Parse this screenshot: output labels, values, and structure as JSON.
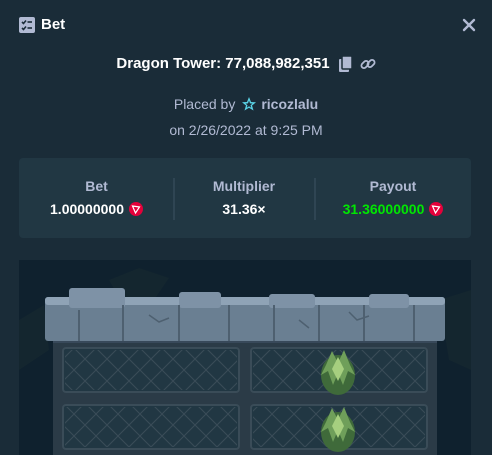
{
  "header": {
    "title": "Bet",
    "icon": "bet-slip-icon",
    "close_icon": "close-icon"
  },
  "game": {
    "title": "Dragon Tower: 77,088,982,351",
    "copy_icon": "copy-icon",
    "link_icon": "link-icon"
  },
  "placed": {
    "prefix": "Placed by",
    "username": "ricozlalu",
    "user_icon": "vip-star-icon",
    "date": "on 2/26/2022 at 9:25 PM"
  },
  "stats": {
    "bet": {
      "label": "Bet",
      "value": "1.00000000",
      "currency_icon": "tron-coin-icon"
    },
    "multiplier": {
      "label": "Multiplier",
      "value": "31.36×"
    },
    "payout": {
      "label": "Payout",
      "value": "31.36000000",
      "currency_icon": "tron-coin-icon"
    }
  },
  "board": {
    "rows": [
      [
        "empty",
        "egg"
      ],
      [
        "empty",
        "egg"
      ]
    ]
  },
  "colors": {
    "background": "#1a2c38",
    "panel": "#213743",
    "label": "#b1bad3",
    "payout": "#00e701",
    "coin": "#e4003a"
  }
}
